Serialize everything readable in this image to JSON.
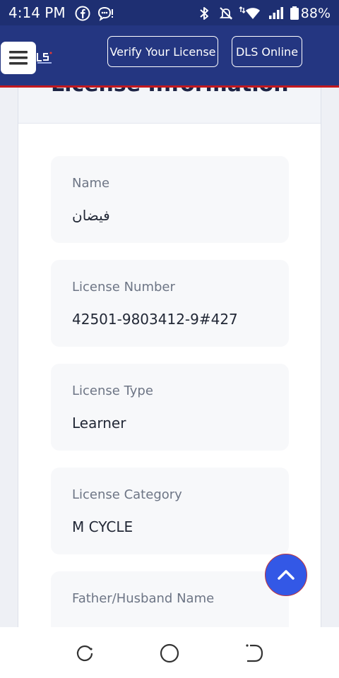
{
  "status_bar": {
    "time": "4:14 PM",
    "battery": "88%",
    "icons": [
      "facebook-icon",
      "chat-bubble-icon",
      "bluetooth-icon",
      "mute-icon",
      "wifi-icon",
      "signal-icon",
      "battery-icon"
    ]
  },
  "header": {
    "menu_icon": "hamburger-icon",
    "logo_text": "LS",
    "verify_label": "Verify Your License",
    "dls_label": "DLS Online",
    "colors": {
      "header_bg": "#243681",
      "accent_line": "#c3181f"
    }
  },
  "card": {
    "title": "License Information"
  },
  "fields": [
    {
      "label": "Name",
      "value": "فيضان"
    },
    {
      "label": "License Number",
      "value": "42501-9803412-9#427"
    },
    {
      "label": "License Type",
      "value": "Learner"
    },
    {
      "label": "License Category",
      "value": "M CYCLE"
    },
    {
      "label": "Father/Husband Name",
      "value": ""
    }
  ],
  "scroll_top": {
    "icon": "chevron-up-icon",
    "color": "#3358e6"
  },
  "nav_bar": {
    "icons": [
      "recent-apps-icon",
      "home-icon",
      "back-icon"
    ]
  }
}
